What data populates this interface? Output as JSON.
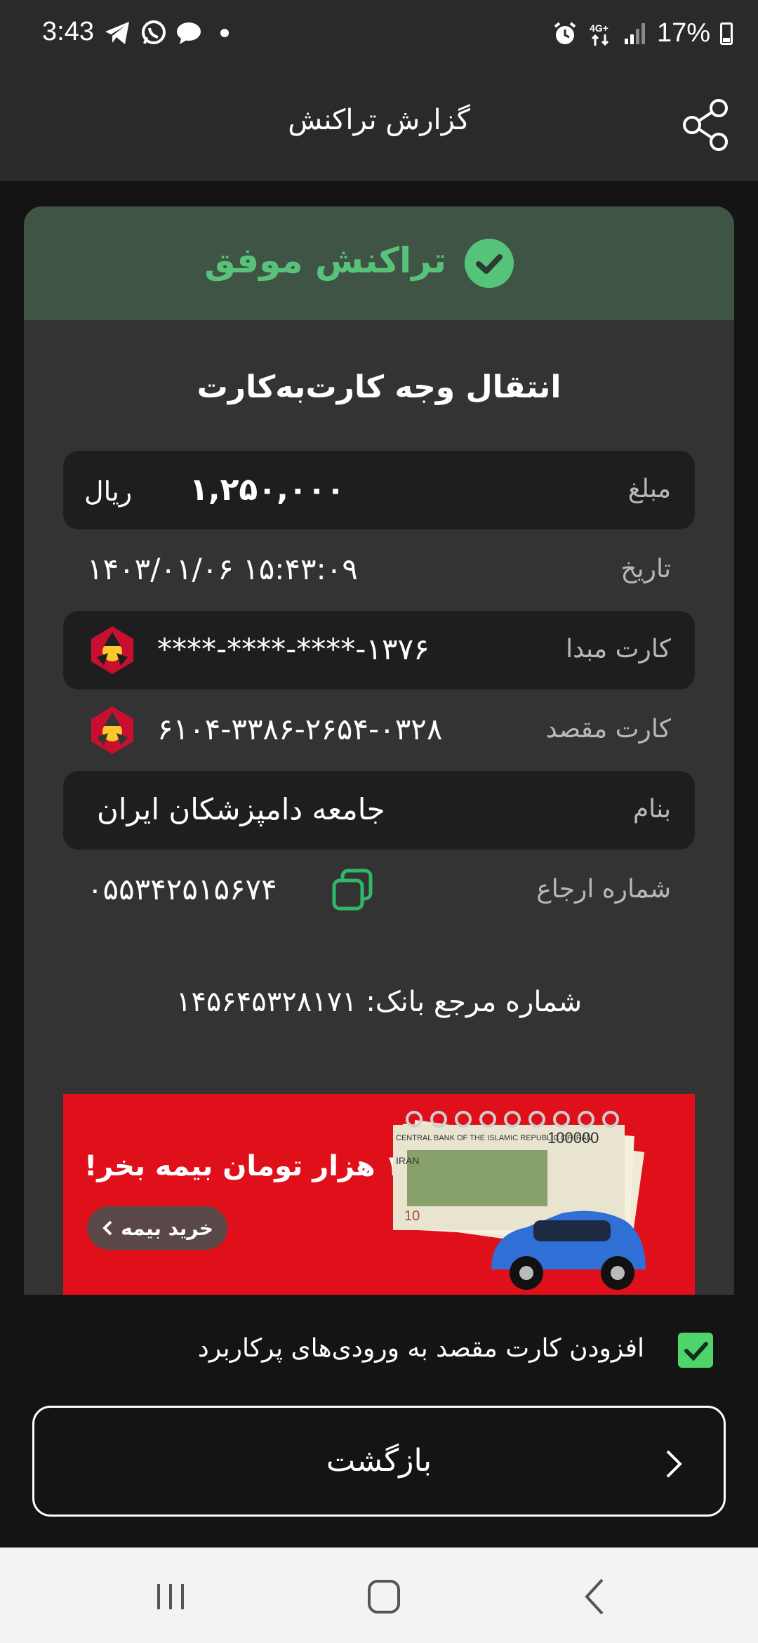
{
  "status_bar": {
    "time": "3:43",
    "network": "4G+",
    "battery": "17%"
  },
  "header": {
    "title": "گزارش تراکنش"
  },
  "result": {
    "status": "تراکنش موفق",
    "status_color": "#59c27a",
    "title": "انتقال وجه کارت‌به‌کارت"
  },
  "details": {
    "amount_label": "مبلغ",
    "amount_value": "۱,۲۵۰,۰۰۰",
    "amount_unit": "ریال",
    "date_label": "تاریخ",
    "date_value": "۱۵:۴۳:۰۹ ۱۴۰۳/۰۱/۰۶",
    "source_label": "کارت مبدا",
    "source_value": "****-****-****-۱۳۷۶",
    "dest_label": "کارت مقصد",
    "dest_value": "۶۱۰۴-۳۳۸۶-۲۶۵۴-۰۳۲۸",
    "name_label": "بنام",
    "name_value": "جامعه دامپزشکان ایران",
    "ref_label": "شماره ارجاع",
    "ref_value": "۰۵۵۳۴۲۵۱۵۶۷۴",
    "bank_ref": "شماره مرجع بانک: ۱۴۵۶۴۵۳۲۸۱۷۱"
  },
  "ad": {
    "title": "با روزی ۱۰ هزار تومان بیمه بخر!",
    "button": "خرید بیمه",
    "bill_top": "CENTRAL BANK OF THE ISLAMIC REPUBLIC OF IRAN",
    "bill_small": "IRAN",
    "bill_value": "100000",
    "bill_corner": "10"
  },
  "footer": {
    "checkbox_label": "افزودن کارت مقصد به ورودی‌های پرکاربرد",
    "checkbox_checked": true,
    "back_button": "بازگشت"
  }
}
